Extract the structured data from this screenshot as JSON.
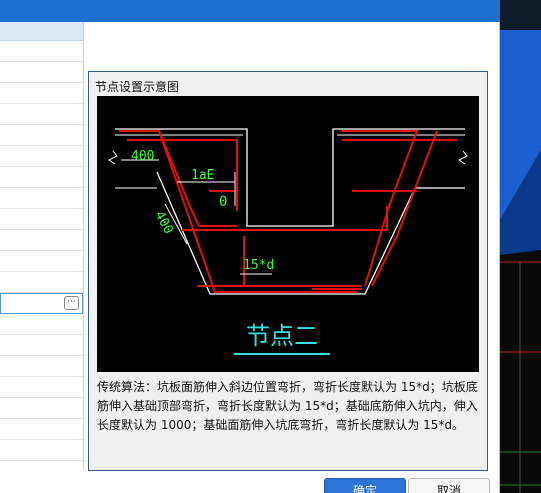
{
  "group": {
    "title": "节点设置示意图"
  },
  "diagram": {
    "label_400_top": "400",
    "label_1aE": "1aE",
    "label_0": "0",
    "label_400_side": "400",
    "label_15d": "15*d",
    "caption": "节点二"
  },
  "description": "传统算法：坑板面筋伸入斜边位置弯折，弯折长度默认为 15*d；坑板底筋伸入基础顶部弯折，弯折长度默认为 15*d；基础底筋伸入坑内，伸入长度默认为 1000；基础面筋伸入坑底弯折，弯折长度默认为 15*d。",
  "buttons": {
    "ok": "确定",
    "cancel": "取消"
  },
  "prop_list": {
    "ellipsis": "···"
  },
  "colors": {
    "accent": "#2b74d6",
    "rebar": "#e01010",
    "dimension": "#33ff33",
    "caption": "#33e0e0"
  }
}
